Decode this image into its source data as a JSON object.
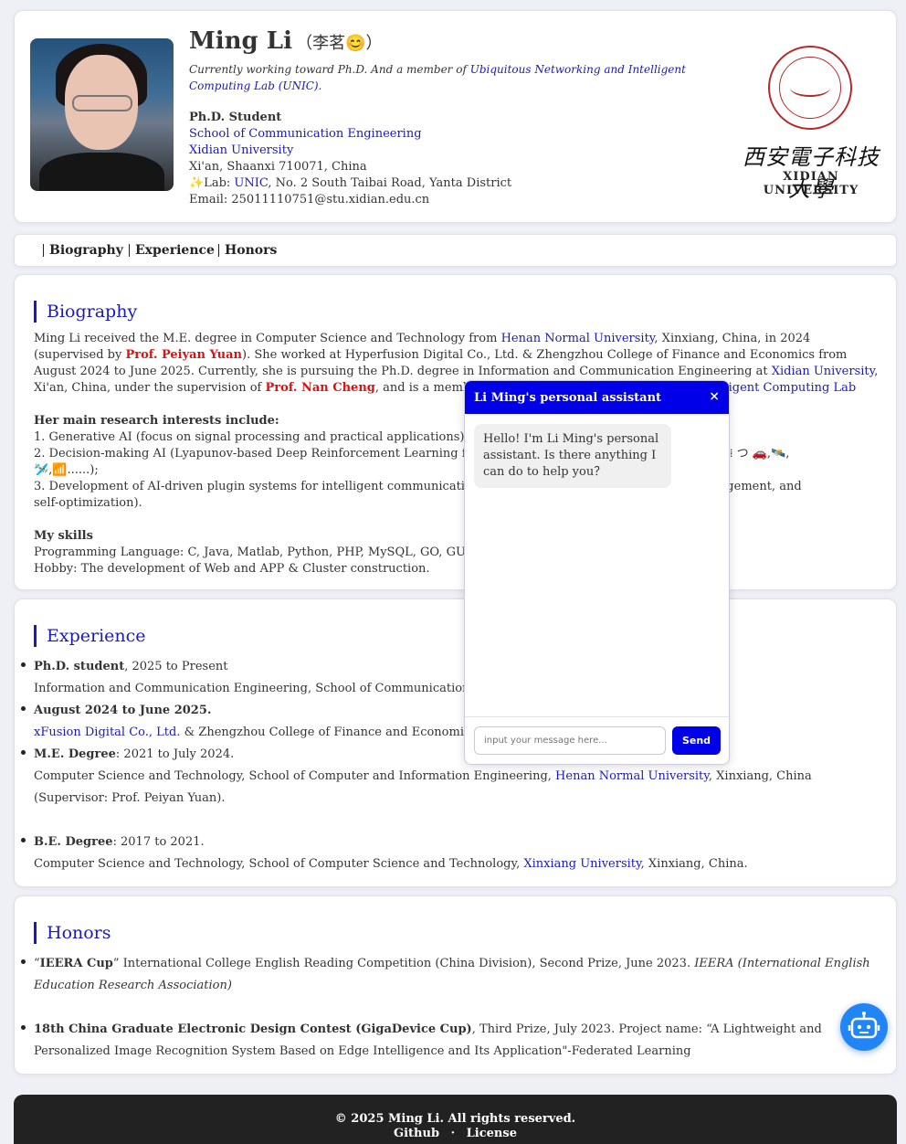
{
  "profile": {
    "name": "Ming Li",
    "name_cn": "（李茗😊）",
    "tagline_prefix": "Currently working toward Ph.D. And a member of ",
    "tagline_link": "Ubiquitous Networking and Intelligent Computing Lab (UNIC).",
    "title": "Ph.D. Student",
    "school": "School of Communication Engineering",
    "university": "Xidian University",
    "address": "Xi'an, Shaanxi 710071, China",
    "lab_prefix": "✨Lab: ",
    "lab_link": "UNIC",
    "lab_suffix": ", No. 2 South Taibai Road, Yanta District",
    "email": "Email: 25011110751@stu.xidian.edu.cn",
    "logo_cn": "西安電子科技大學",
    "logo_en": "XIDIAN UNIVERSITY"
  },
  "nav": [
    "Biography",
    "Experience",
    "Honors"
  ],
  "biography": {
    "title": "Biography",
    "p1": "Ming Li received the M.E. degree in Computer Science and Technology from ",
    "p1_link1": "Henan Normal University",
    "p1_b": ", Xinxiang, China, in 2024 (supervised by ",
    "p1_red1": "Prof. Peiyan Yuan",
    "p1_c": "). She worked at Hyperfusion Digital Co., Ltd. & Zhengzhou College of Finance and Economics from August 2024 to June 2025. Currently, she is pursuing the Ph.D. degree in Information and Communication Engineering at ",
    "p1_link2": "Xidian University",
    "p1_d": ", Xi'an, China, under the supervision of ",
    "p1_red2": "Prof. Nan Cheng",
    "p1_e": ", and is a member of the ",
    "p1_link3": "Ubiquitous Networking and Intelligent Computing Lab",
    "interests_title": "Her main research interests include:",
    "interest1": "1. Generative AI (focus on signal processing and practical applications);",
    "interest2": "2. Decision-making AI (Lyapunov-based Deep Reinforcement Learning for Reso",
    "interest2_end": "arios( • - • ) ⁞ つ 🚗,🛰️,",
    "interest2_line2": "🛩️,📶......);",
    "interest3": "3. Development of AI-driven plugin systems for intelligent communication syste",
    "interest3_end": "source management, and",
    "interest3_line2": "self-optimization).",
    "skills_title": "My skills",
    "skills1": "Programming Language: C, Java, Matlab, Python, PHP, MySQL, GO, GUN/Linu",
    "skills2": "Hobby: The development of Web and APP & Cluster construction."
  },
  "experience": {
    "title": "Experience",
    "items": [
      {
        "head_bold": "Ph.D. student",
        "head_rest": ", 2025 to Present",
        "desc": "Information and Communication Engineering, School of Communication Engin"
      },
      {
        "head_bold": "August 2024 to June 2025.",
        "head_rest": "",
        "desc_link": "xFusion Digital Co., Ltd.",
        "desc": " & Zhengzhou College of Finance and Economics, Zhen"
      },
      {
        "head_bold": "M.E. Degree",
        "head_rest": ": 2021 to July 2024.",
        "desc_pre": "Computer Science and Technology, School of Computer and Information Engineering, ",
        "desc_link": "Henan Normal University",
        "desc": ", Xinxiang, China (Supervisor: Prof. Peiyan Yuan)."
      },
      {
        "head_bold": "B.E. Degree",
        "head_rest": ": 2017 to 2021.",
        "desc_pre": "Computer Science and Technology, School of Computer Science and Technology, ",
        "desc_link": "Xinxiang University",
        "desc": ", Xinxiang, China."
      }
    ]
  },
  "honors": {
    "title": "Honors",
    "items": [
      {
        "bold": "IEERA Cup",
        "pre": "“",
        "mid": "” International College English Reading Competition (China Division), Second Prize, June 2023. ",
        "italic": "IEERA (International English Education Research Association)"
      },
      {
        "bold": "18th China Graduate Electronic Design Contest (GigaDevice Cup)",
        "pre": "",
        "mid": ", Third Prize, July 2023. Project name: “A Lightweight and Personalized Image Recognition System Based on Edge Intelligence and Its Application\"-Federated Learning",
        "italic": ""
      }
    ]
  },
  "footer": {
    "copyright": "© 2025 Ming Li. All rights reserved.",
    "github": "Github",
    "sep": "·",
    "license": "License"
  },
  "chat": {
    "title": "Li Ming's personal assistant",
    "close": "×",
    "greeting": "Hello! I'm Li Ming's personal assistant. Is there anything I can do to help you？",
    "placeholder": "input your message here...",
    "send": "Send"
  }
}
